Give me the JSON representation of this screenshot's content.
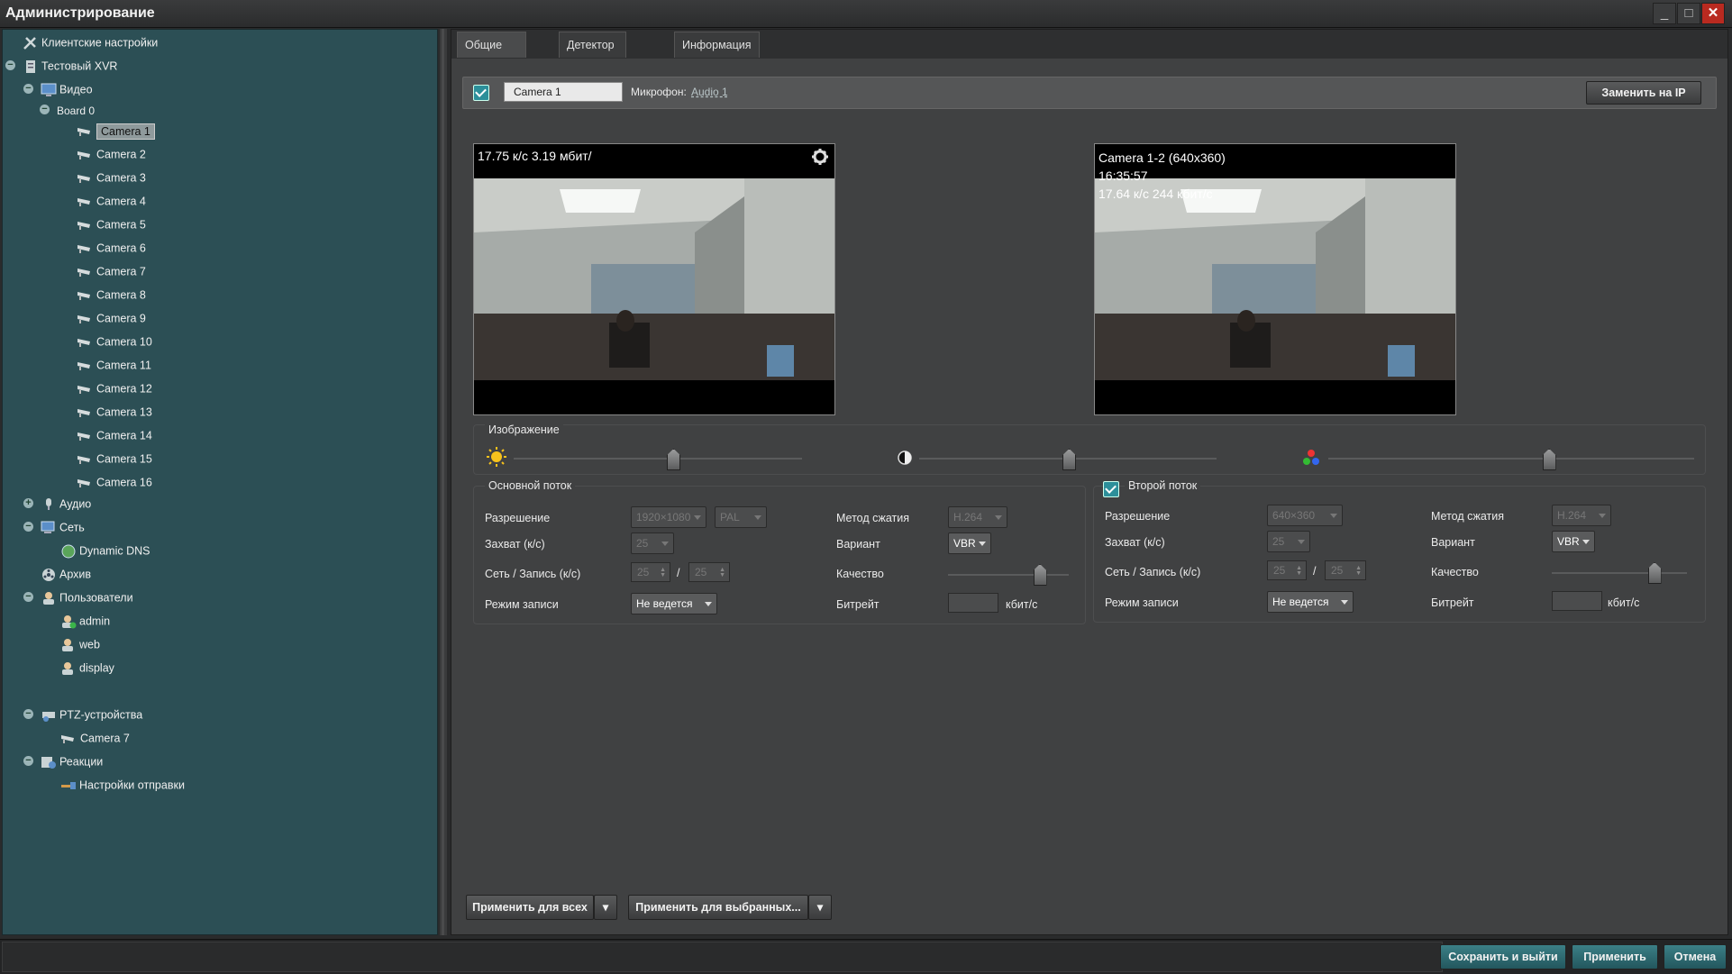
{
  "window": {
    "title": "Администрирование"
  },
  "tree": {
    "client_settings": "Клиентские настройки",
    "xvr": "Тестовый XVR",
    "video": "Видео",
    "board": "Board 0",
    "cameras": [
      "Camera 1",
      "Camera 2",
      "Camera 3",
      "Camera 4",
      "Camera 5",
      "Camera 6",
      "Camera 7",
      "Camera 8",
      "Camera 9",
      "Camera 10",
      "Camera 11",
      "Camera 12",
      "Camera 13",
      "Camera 14",
      "Camera 15",
      "Camera 16"
    ],
    "audio": "Аудио",
    "network": "Сеть",
    "ddns": "Dynamic DNS",
    "archive": "Архив",
    "users": "Пользователи",
    "user_items": [
      "admin",
      "web",
      "display"
    ],
    "ptz": "PTZ-устройства",
    "ptz_camera": "Camera 7",
    "reactions": "Реакции",
    "send_settings": "Настройки отправки"
  },
  "tabs": [
    "Общие настройки",
    "Детектор движения",
    "Информация"
  ],
  "camera": {
    "name": "Camera 1",
    "mic_label": "Микрофон:",
    "mic_value": "Audio 1",
    "replace_btn": "Заменить на IP"
  },
  "video_main": {
    "overlay": "17.75 к/с 3.19 мбит/"
  },
  "video_second": {
    "line1": "Camera 1-2 (640x360)",
    "line2": "16:35:57",
    "line3": "17.64 к/с 244 кбит/с"
  },
  "image": {
    "title": "Изображение",
    "brightness": 0.55,
    "contrast": 0.5,
    "saturation": 0.6
  },
  "main_stream": {
    "title": "Основной поток",
    "resolution_label": "Разрешение",
    "resolution": "1920×1080",
    "standard": "PAL",
    "capture_label": "Захват (к/с)",
    "capture": "25",
    "net_label": "Сеть / Запись (к/с)",
    "net": "25",
    "rec": "25",
    "mode_label": "Режим записи",
    "mode": "Не ведется",
    "codec_label": "Метод сжатия",
    "codec": "H.264",
    "variant_label": "Вариант",
    "variant": "VBR",
    "quality_label": "Качество",
    "quality": 0.75,
    "bitrate_label": "Битрейт",
    "bitrate_unit": "кбит/с"
  },
  "second_stream": {
    "title": "Второй поток",
    "resolution_label": "Разрешение",
    "resolution": "640×360",
    "capture_label": "Захват (к/с)",
    "capture": "25",
    "net_label": "Сеть / Запись (к/с)",
    "net": "25",
    "rec": "25",
    "mode_label": "Режим записи",
    "mode": "Не ведется",
    "codec_label": "Метод сжатия",
    "codec": "H.264",
    "variant_label": "Вариант",
    "variant": "VBR",
    "quality_label": "Качество",
    "quality": 0.75,
    "bitrate_label": "Битрейт",
    "bitrate_unit": "кбит/с"
  },
  "footer": {
    "apply_all": "Применить для всех",
    "apply_selected": "Применить для выбранных...",
    "save_exit": "Сохранить и выйти",
    "apply": "Применить",
    "cancel": "Отмена"
  },
  "colors": {
    "tree_bg": "#2c4f55",
    "accent": "#2c8f9a",
    "close": "#b92a20"
  }
}
